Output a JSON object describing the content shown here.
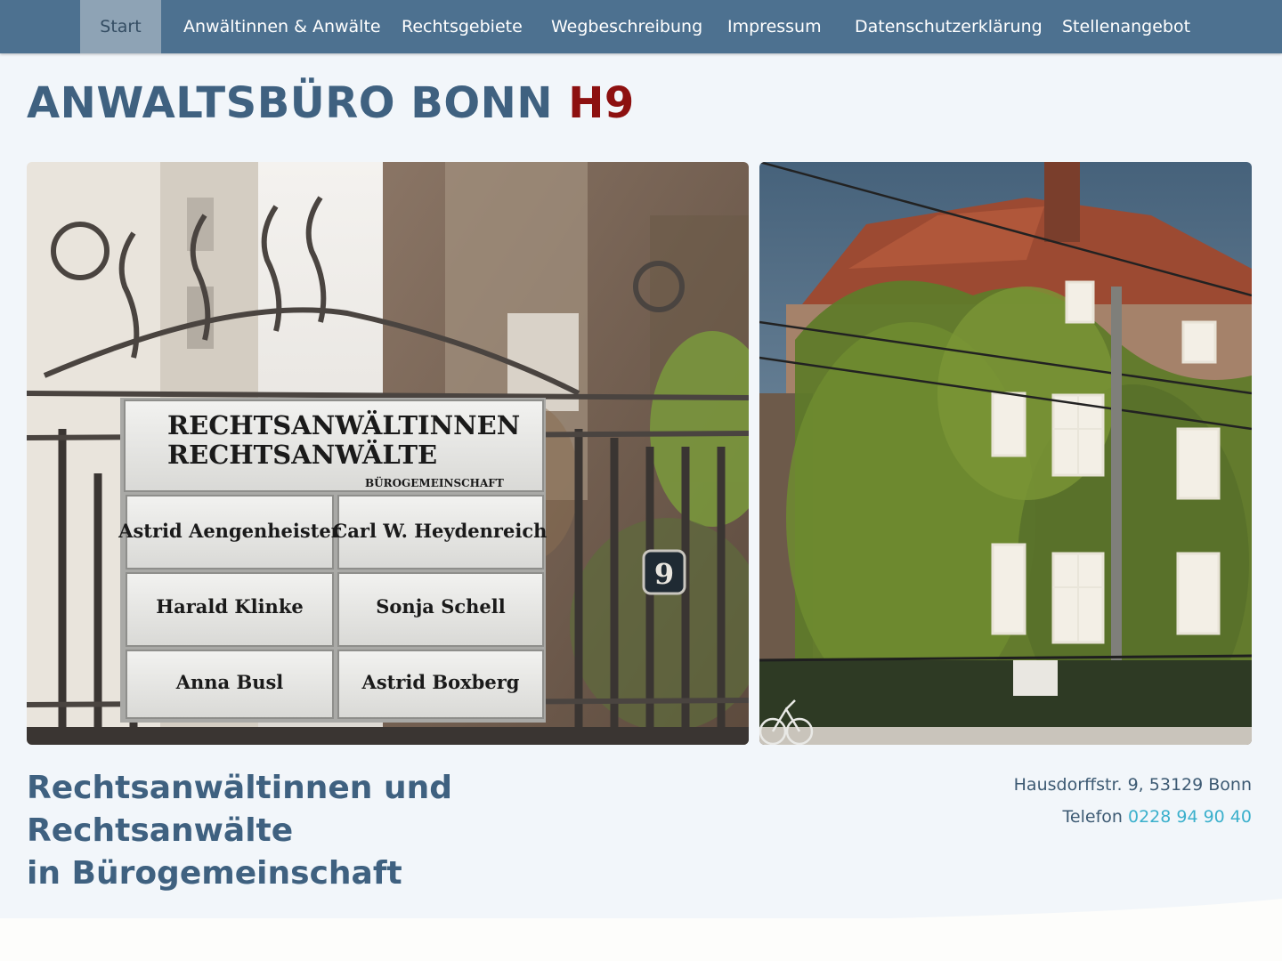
{
  "nav": {
    "items": [
      {
        "label": "Start",
        "active": true
      },
      {
        "label": "Anwältinnen & Anwälte"
      },
      {
        "label": "Rechtsgebiete"
      },
      {
        "label": "Wegbeschreibung"
      },
      {
        "label": "Impressum"
      },
      {
        "label": "Datenschutzerklärung"
      },
      {
        "label": "Stellenangebot"
      }
    ]
  },
  "header": {
    "title_main": "ANWALTSBÜRO BONN",
    "title_accent": "H9"
  },
  "gate_sign": {
    "line1": "RECHTSANWÄLTINNEN",
    "line2": "RECHTSANWÄLTE",
    "line3": "BÜROGEMEINSCHAFT",
    "names": [
      "Astrid Aengenheister",
      "Carl W. Heydenreich",
      "Harald Klinke",
      "Sonja Schell",
      "Anna Busl",
      "Astrid Boxberg"
    ],
    "house_number": "9"
  },
  "tagline": {
    "line1": "Rechtsanwältinnen und Rechtsanwälte",
    "line2": "in Bürogemeinschaft"
  },
  "contact": {
    "address": "Hausdorffstr. 9, 53129 Bonn",
    "phone_label": "Telefon",
    "phone_number": "0228 94 90 40"
  },
  "colors": {
    "nav_bg": "#4d7190",
    "nav_active_bg": "#8ea3b5",
    "title": "#3f6180",
    "accent": "#8d1010",
    "link": "#3bb0cc",
    "page_bg": "#f2f6fa"
  }
}
